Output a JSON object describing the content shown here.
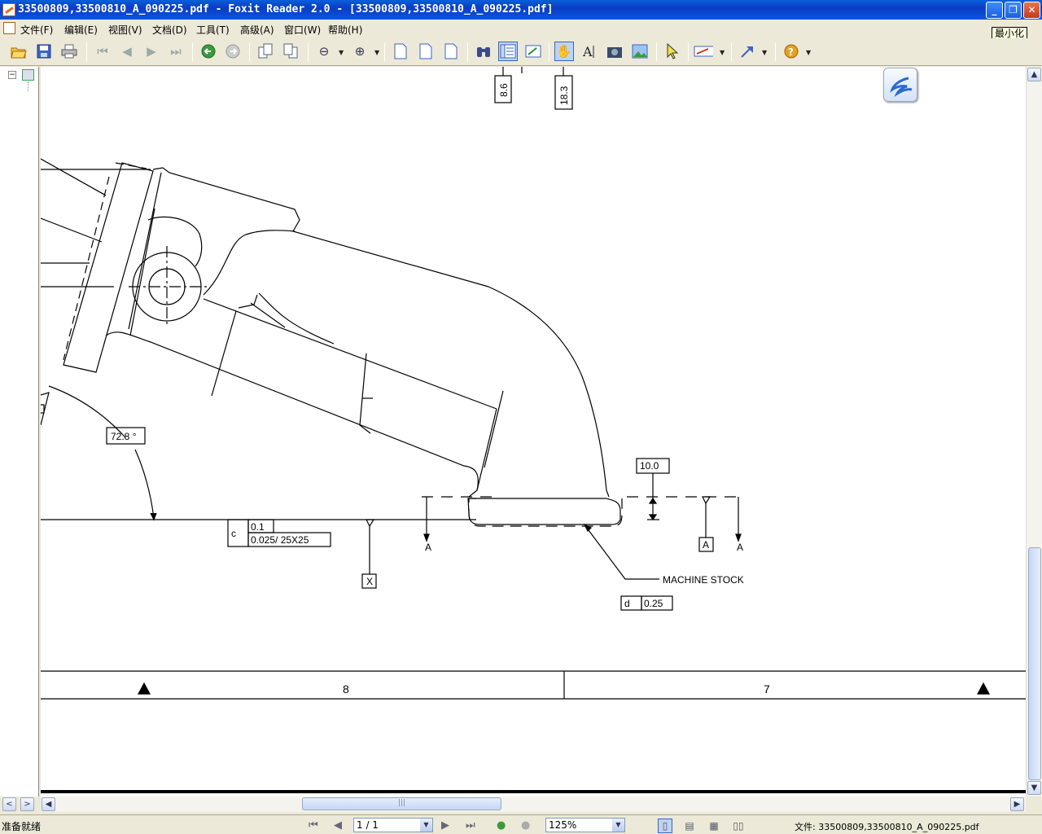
{
  "window": {
    "title": "33500809,33500810_A_090225.pdf - Foxit Reader 2.0 - [33500809,33500810_A_090225.pdf]",
    "minimize_glyph": "_",
    "maximize_glyph": "❐",
    "close_glyph": "✕",
    "menu_close_glyph": "×"
  },
  "menu": {
    "items": [
      "文件(F)",
      "编辑(E)",
      "视图(V)",
      "文档(D)",
      "工具(T)",
      "高级(A)",
      "窗口(W)",
      "帮助(H)"
    ],
    "tooltip": "最小化"
  },
  "toolbar": {
    "icons": [
      "open-icon",
      "save-icon",
      "print-icon",
      "first-page-icon",
      "prev-page-icon",
      "next-page-icon",
      "last-page-icon",
      "go-back-icon",
      "go-forward-icon",
      "rotate-left-icon",
      "rotate-right-icon",
      "zoom-out-icon",
      "zoom-in-icon",
      "actual-size-icon",
      "fit-page-icon",
      "fit-width-icon",
      "find-icon",
      "bookmarks-toggle-icon",
      "ink-sign-icon",
      "hand-tool-icon",
      "text-select-icon",
      "snapshot-icon",
      "image-select-icon",
      "select-arrow-icon",
      "typewriter-icon",
      "annotation-icon",
      "help-icon"
    ]
  },
  "drawing": {
    "dim_8_6": "8.6",
    "dim_18_3": "18.3",
    "angle": "72.8 °",
    "dim_10_0": "10.0",
    "fcf_c_symbol": "c",
    "fcf_c_value1": "0.1",
    "fcf_c_value2": "0.025/ 25X25",
    "datum_x": "X",
    "section_a_left": "A",
    "datum_a": "A",
    "section_a_right": "A",
    "machine_stock": "MACHINE STOCK",
    "fcf_d_symbol": "d",
    "fcf_d_value": "0.25",
    "zone_left": "8",
    "zone_right": "7"
  },
  "statusbar": {
    "status": "准备就绪",
    "page": "1 / 1",
    "zoom": "125%",
    "file_label": "文件: 33500809,33500810_A_090225.pdf"
  },
  "colors": {
    "titlebar": "#0a46d0",
    "chrome": "#ece9d8",
    "scroll_thumb": "#c6d6f5"
  }
}
